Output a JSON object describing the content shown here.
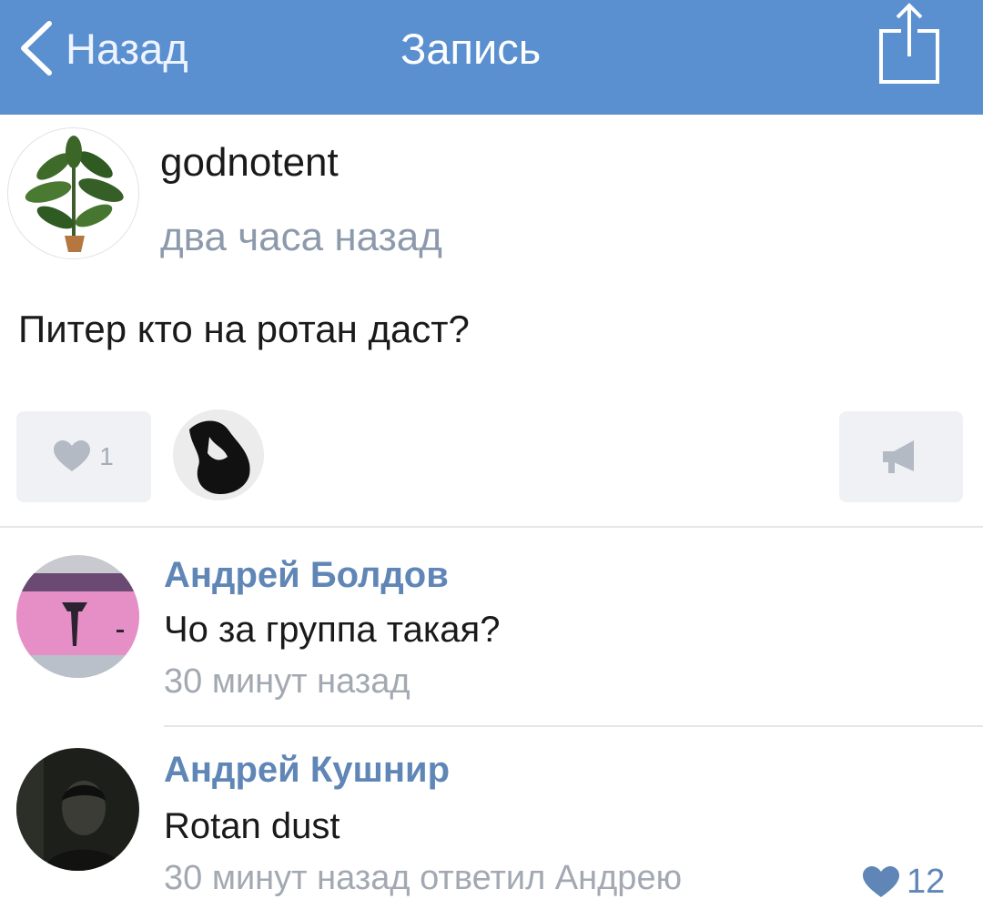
{
  "navbar": {
    "back_label": "Назад",
    "title": "Запись",
    "color": "#5a8fd0"
  },
  "post": {
    "author": "godnotent",
    "time": "два часа назад",
    "text": "Питер кто на ротан даст?",
    "likes": "1"
  },
  "comments": [
    {
      "author": "Андрей Болдов",
      "text": "Чо за группа такая?",
      "time": "30 минут назад",
      "reply": "",
      "likes": ""
    },
    {
      "author": "Андрей Кушнир",
      "text": "Rotan dust",
      "time": "30 минут назад",
      "reply": "ответил Андрею",
      "likes": "12"
    }
  ],
  "icons": {
    "back": "chevron-left-icon",
    "share": "share-icon",
    "like": "heart-icon",
    "repost": "megaphone-icon"
  },
  "colors": {
    "link": "#5f86b6",
    "muted": "#a3a9b2"
  }
}
